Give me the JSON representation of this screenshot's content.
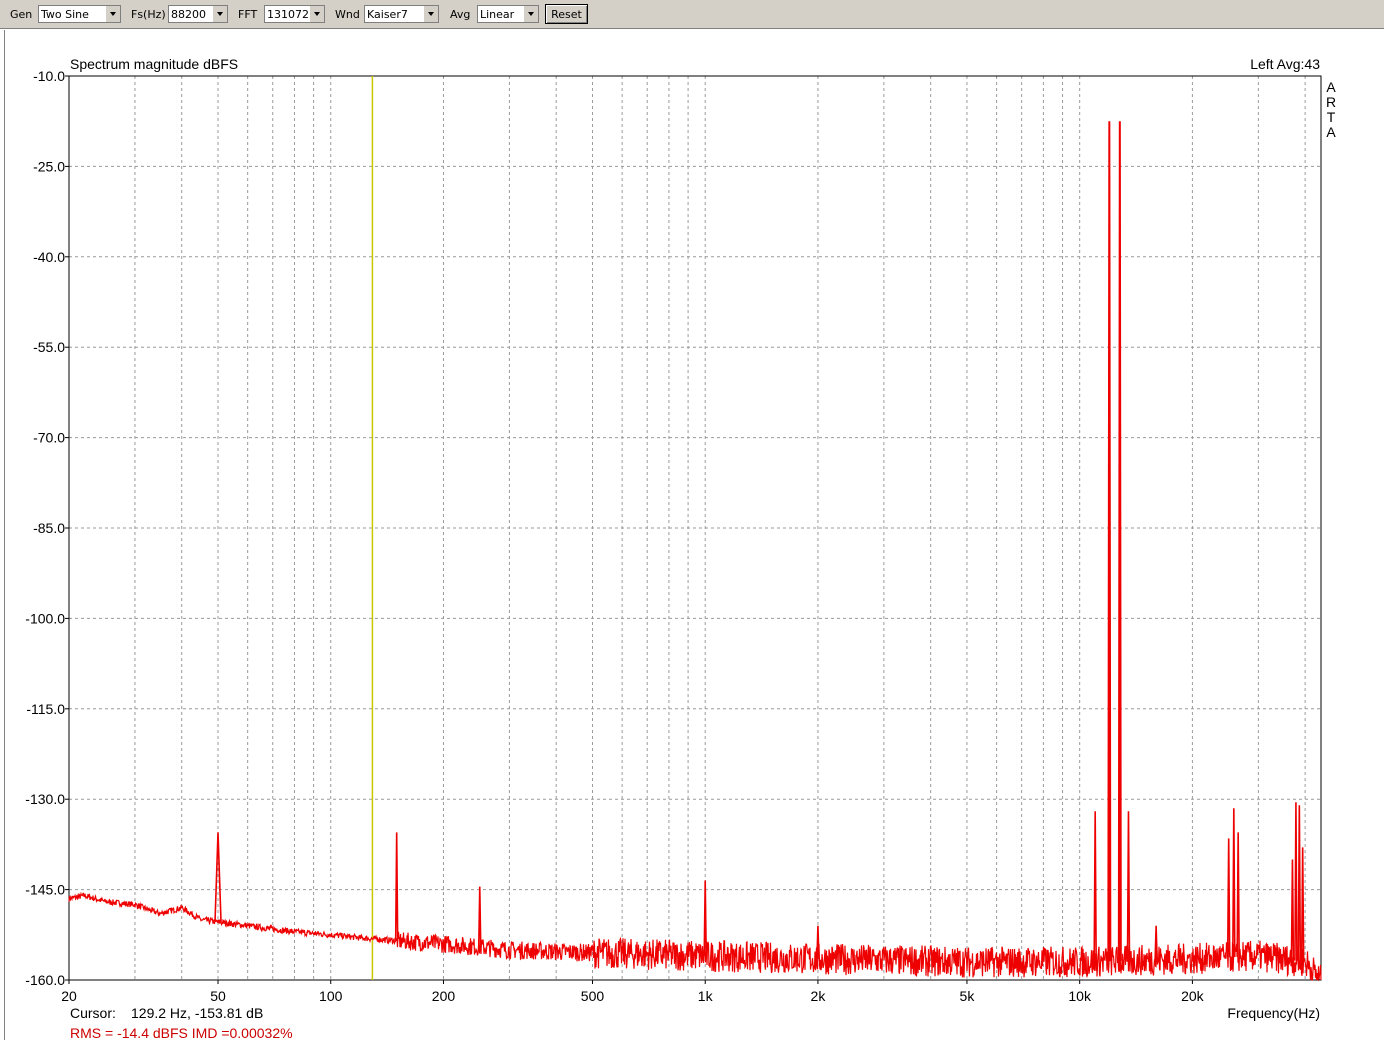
{
  "toolbar": {
    "gen_label": "Gen",
    "gen_value": "Two Sine",
    "fs_label": "Fs(Hz)",
    "fs_value": "88200",
    "fft_label": "FFT",
    "fft_value": "131072",
    "wnd_label": "Wnd",
    "wnd_value": "Kaiser7",
    "avg_label": "Avg",
    "avg_value": "Linear",
    "reset_label": "Reset"
  },
  "status": {
    "cursor_label": "Cursor:",
    "cursor_value": "129.2 Hz, -153.81 dB",
    "rms_text": "RMS =  -14.4 dBFS   IMD =0.00032%"
  },
  "colors": {
    "trace": "#ee0000",
    "cursor": "#c8c800",
    "grid": "#9a9a9a",
    "status_text": "#cc0000"
  },
  "chart_data": {
    "type": "line",
    "title": "Spectrum magnitude dBFS",
    "channel_text": "Left  Avg:43",
    "watermark": [
      "A",
      "R",
      "T",
      "A"
    ],
    "xlabel": "Frequency(Hz)",
    "ylabel": "",
    "x_scale": "log",
    "xlim": [
      20,
      44100
    ],
    "ylim": [
      -160,
      -10
    ],
    "y_ticks": [
      -10.0,
      -25.0,
      -40.0,
      -55.0,
      -70.0,
      -85.0,
      -100.0,
      -115.0,
      -130.0,
      -145.0,
      -160.0
    ],
    "y_tick_labels": [
      "-10.0",
      "-25.0",
      "-40.0",
      "-55.0",
      "-70.0",
      "-85.0",
      "-100.0",
      "-115.0",
      "-130.0",
      "-145.0",
      "-160.0"
    ],
    "x_ticks": [
      20,
      50,
      100,
      200,
      500,
      1000,
      2000,
      5000,
      10000,
      20000
    ],
    "x_tick_labels": [
      "20",
      "50",
      "100",
      "200",
      "500",
      "1k",
      "2k",
      "5k",
      "10k",
      "20k"
    ],
    "grid": true,
    "cursor_x": 129.2,
    "series": [
      {
        "color": "#ee0000",
        "noise_floor": [
          [
            20,
            -146.5
          ],
          [
            22,
            -146
          ],
          [
            25,
            -147
          ],
          [
            30,
            -147.5
          ],
          [
            35,
            -149
          ],
          [
            40,
            -148
          ],
          [
            45,
            -150
          ],
          [
            60,
            -151
          ],
          [
            80,
            -152
          ],
          [
            100,
            -152.5
          ],
          [
            120,
            -153
          ],
          [
            150,
            -153.5
          ],
          [
            200,
            -154
          ],
          [
            300,
            -155
          ],
          [
            500,
            -155.5
          ],
          [
            1000,
            -156
          ],
          [
            2000,
            -156.5
          ],
          [
            5000,
            -157
          ],
          [
            10000,
            -157
          ],
          [
            20000,
            -156.5
          ],
          [
            30000,
            -156
          ],
          [
            40000,
            -157
          ],
          [
            44100,
            -160
          ]
        ],
        "peaks": [
          {
            "x": 50,
            "y": -135.5
          },
          {
            "x": 150,
            "y": -135.5
          },
          {
            "x": 250,
            "y": -144.5
          },
          {
            "x": 1000,
            "y": -143.5
          },
          {
            "x": 2000,
            "y": -151
          },
          {
            "x": 11000,
            "y": -132
          },
          {
            "x": 12000,
            "y": -17.5
          },
          {
            "x": 12800,
            "y": -17.5
          },
          {
            "x": 13500,
            "y": -132
          },
          {
            "x": 16000,
            "y": -151
          },
          {
            "x": 25000,
            "y": -136.5
          },
          {
            "x": 25800,
            "y": -131.5
          },
          {
            "x": 26500,
            "y": -135.5
          },
          {
            "x": 37000,
            "y": -140
          },
          {
            "x": 37800,
            "y": -130.5
          },
          {
            "x": 38600,
            "y": -131
          },
          {
            "x": 39400,
            "y": -138
          }
        ]
      }
    ]
  }
}
